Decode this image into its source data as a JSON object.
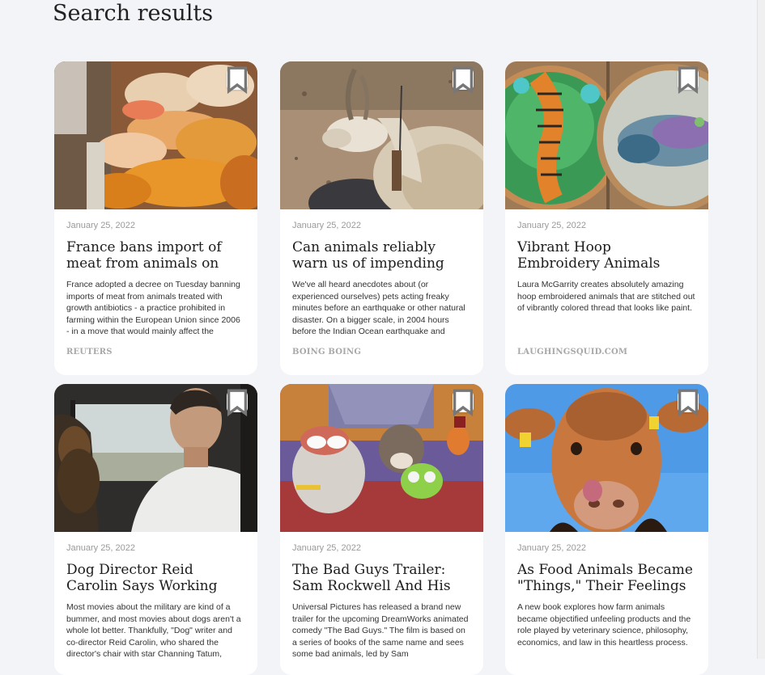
{
  "page": {
    "title": "Search results"
  },
  "cards": [
    {
      "image": "raw-chicken-market-photo",
      "date": "January 25, 2022",
      "title": "France bans import of meat from animals on",
      "description": "France adopted a decree on Tuesday banning imports of meat from animals treated with growth antibiotics - a practice prohibited in farming within the European Union since 2006 - in a move that would mainly affect the",
      "source": "REUTERS"
    },
    {
      "image": "goat-with-collar-photo",
      "date": "January 25, 2022",
      "title": "Can animals reliably warn us of impending",
      "description": "We've all heard anecdotes about (or experienced ourselves) pets acting freaky minutes before an earthquake or other natural disaster. On a bigger scale, in 2004 hours before the Indian Ocean earthquake and",
      "source": "BOING BOING"
    },
    {
      "image": "embroidery-hoops-tiger-hippo-photo",
      "date": "January 25, 2022",
      "title": "Vibrant Hoop Embroidery Animals",
      "description": "Laura McGarrity creates absolutely amazing hoop embroidered animals that are stitched out of vibrantly colored thread that looks like paint.",
      "source": "LAUGHINGSQUID.COM"
    },
    {
      "image": "man-and-dog-in-car-photo",
      "date": "January 25, 2022",
      "title": "Dog Director Reid Carolin Says Working With",
      "description": "Most movies about the military are kind of a bummer, and most movies about dogs aren't a whole lot better. Thankfully, \"Dog\" writer and co-director Reid Carolin, who shared the director's chair with star Channing Tatum,",
      "source": ""
    },
    {
      "image": "bad-guys-animated-still",
      "date": "January 25, 2022",
      "title": "The Bad Guys Trailer: Sam Rockwell And His Gang Of",
      "description": "Universal Pictures has released a brand new trailer for the upcoming DreamWorks animated comedy \"The Bad Guys.\" The film is based on a series of books of the same name and sees some bad animals, led by Sam",
      "source": ""
    },
    {
      "image": "cow-licking-nose-photo",
      "date": "January 25, 2022",
      "title": "As Food Animals Became \"Things,\" Their Feelings",
      "description": "A new book explores how farm animals became objectified unfeeling products and the role played by veterinary science, philosophy, economics, and law in this heartless process.",
      "source": ""
    }
  ],
  "icons": {
    "bookmark": "bookmark-icon"
  },
  "colors": {
    "background": "#f3f4f7",
    "card": "#ffffff",
    "date": "#9a9a9a",
    "source": "#a8a8a8"
  }
}
